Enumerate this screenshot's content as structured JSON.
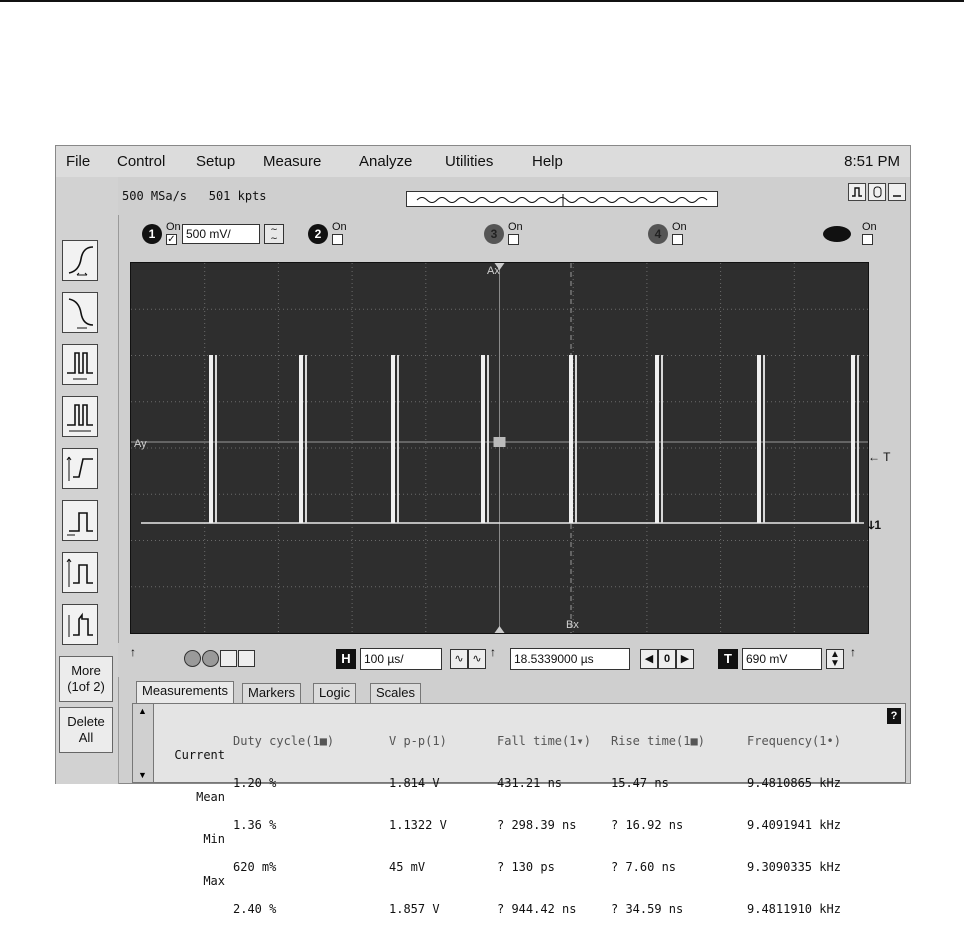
{
  "menu": {
    "items": [
      "File",
      "Control",
      "Setup",
      "Measure",
      "Analyze",
      "Utilities",
      "Help"
    ],
    "clock": "8:51 PM"
  },
  "acquisition": {
    "sample_rate": "500 MSa/s",
    "points": "501 kpts"
  },
  "channels": {
    "ch1": {
      "num": "1",
      "on_label": "On",
      "checked": "✓",
      "scale": "500 mV/"
    },
    "ch2": {
      "num": "2",
      "on_label": "On"
    },
    "ch3": {
      "num": "3",
      "on_label": "On"
    },
    "ch4": {
      "num": "4",
      "on_label": "On"
    },
    "math": {
      "on_label": "On"
    }
  },
  "scope": {
    "marker_ax_top": "Ax",
    "marker_ax_left": "Ay",
    "marker_bx": "Bx",
    "trigger_label": "← T",
    "ground_label": "ↆ1"
  },
  "horizontal": {
    "label": "H",
    "scale": "100 µs/",
    "delay": "18.5339000 µs",
    "nav_center": "0"
  },
  "trigger": {
    "label": "T",
    "level": "690 mV"
  },
  "side_buttons": {
    "more": "More\n(1of 2)",
    "delete": "Delete\nAll"
  },
  "tabs": [
    "Measurements",
    "Markers",
    "Logic",
    "Scales"
  ],
  "measurements": {
    "row_labels": [
      "Current",
      "Mean",
      "Min",
      "Max"
    ],
    "columns": [
      {
        "header": "Duty cycle(1■)",
        "values": [
          "1.20 %",
          "1.36 %",
          "620 m%",
          "2.40 %"
        ]
      },
      {
        "header": "V p-p(1)",
        "values": [
          "1.814 V",
          "1.1322 V",
          "45 mV",
          "1.857 V"
        ]
      },
      {
        "header": "Fall time(1▾)",
        "values": [
          "431.21 ns",
          "? 298.39 ns",
          "? 130 ps",
          "? 944.42 ns"
        ]
      },
      {
        "header": "Rise time(1■)",
        "values": [
          "15.47 ns",
          "? 16.92 ns",
          "? 7.60 ns",
          "? 34.59 ns"
        ]
      },
      {
        "header": "Frequency(1•)",
        "values": [
          "9.4810865 kHz",
          "9.4091941 kHz",
          "9.3090335 kHz",
          "9.4811910 kHz"
        ]
      }
    ],
    "help": "?"
  }
}
